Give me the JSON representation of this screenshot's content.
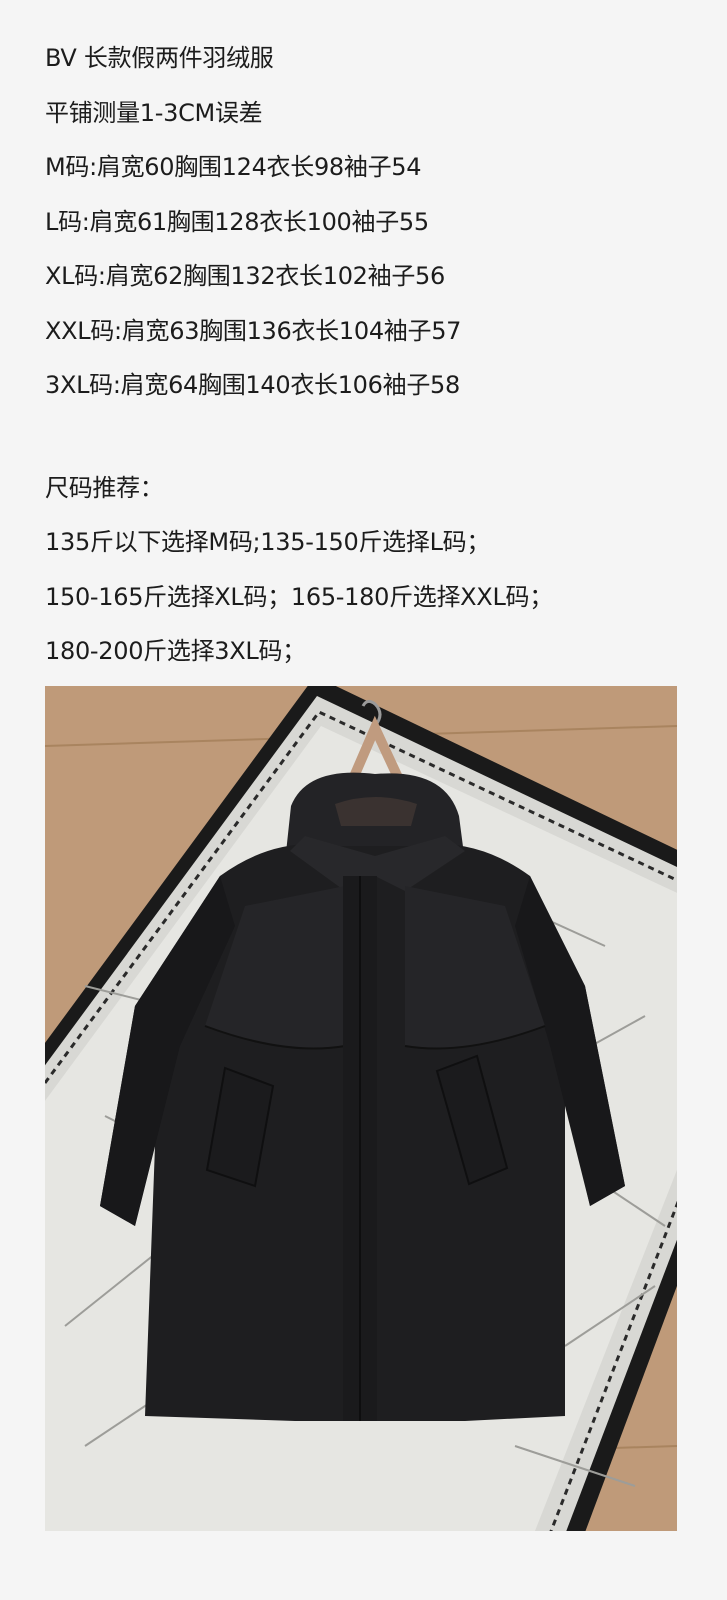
{
  "product": {
    "title": "BV 长款假两件羽绒服",
    "measure_note": "平铺测量1-3CM误差"
  },
  "sizes": [
    "M码:肩宽60胸围124衣长98袖子54",
    "L码:肩宽61胸围128衣长100袖子55",
    "XL码:肩宽62胸围132衣长102袖子56",
    "XXL码:肩宽63胸围136衣长104袖子57",
    "3XL码:肩宽64胸围140衣长106袖子58"
  ],
  "recommend": {
    "heading": "尺码推荐：",
    "lines": [
      "135斤以下选择M码;135-150斤选择L码；",
      "150-165斤选择XL码；165-180斤选择XXL码；",
      "180-200斤选择3XL码；"
    ]
  },
  "colors": {
    "background": "#f5f5f5",
    "text": "#1c1c1c",
    "floor": "#bf9a79",
    "rug": "#e6e6e2",
    "rug_border": "#1a1a1a",
    "coat": "#1e1e20"
  }
}
